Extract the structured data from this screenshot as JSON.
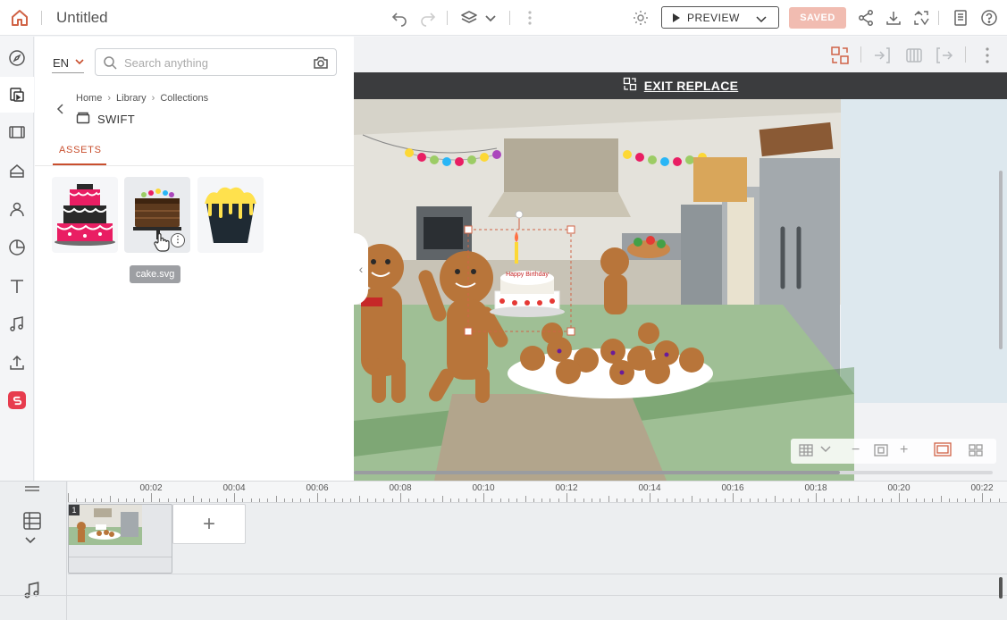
{
  "app": {
    "title": "Untitled",
    "preview_label": "PREVIEW",
    "saved_label": "SAVED"
  },
  "colors": {
    "accent": "#c94f2e",
    "saved_bg": "#f1bcb1",
    "exit_bar_bg": "#3b3c3e",
    "brand_red": "#e73c4e"
  },
  "top_icons": [
    "home-icon",
    "undo-icon",
    "redo-icon",
    "layers-icon",
    "kebab-icon",
    "gear-icon",
    "share-icon",
    "download-icon",
    "translate-icon",
    "notes-icon",
    "help-icon"
  ],
  "rail": {
    "items": [
      "compass-icon",
      "library-icon",
      "scenes-icon",
      "characters-icon",
      "person-icon",
      "chart-icon",
      "text-icon",
      "music-icon",
      "upload-icon",
      "brand-icon"
    ],
    "active": "library-icon"
  },
  "library": {
    "language": "EN",
    "search_placeholder": "Search anything",
    "breadcrumb": [
      "Home",
      "Library",
      "Collections"
    ],
    "collection_name": "SWIFT",
    "tab": "ASSETS",
    "assets": [
      {
        "name": "pink-layer-cake",
        "hover": false
      },
      {
        "name": "chocolate-cake",
        "hover": true
      },
      {
        "name": "yellow-cupcake",
        "hover": false
      }
    ],
    "tooltip": "cake.svg"
  },
  "canvas": {
    "exit_replace_label": "EXIT REPLACE",
    "cake_topper_text": "Happy Birthday"
  },
  "timeline": {
    "tick_labels": [
      "00:02",
      "00:04",
      "00:06",
      "00:08",
      "00:10",
      "00:12",
      "00:14",
      "00:16",
      "00:18",
      "00:20",
      "00:22"
    ],
    "scene_number": "1",
    "add_scene_label": "+"
  }
}
